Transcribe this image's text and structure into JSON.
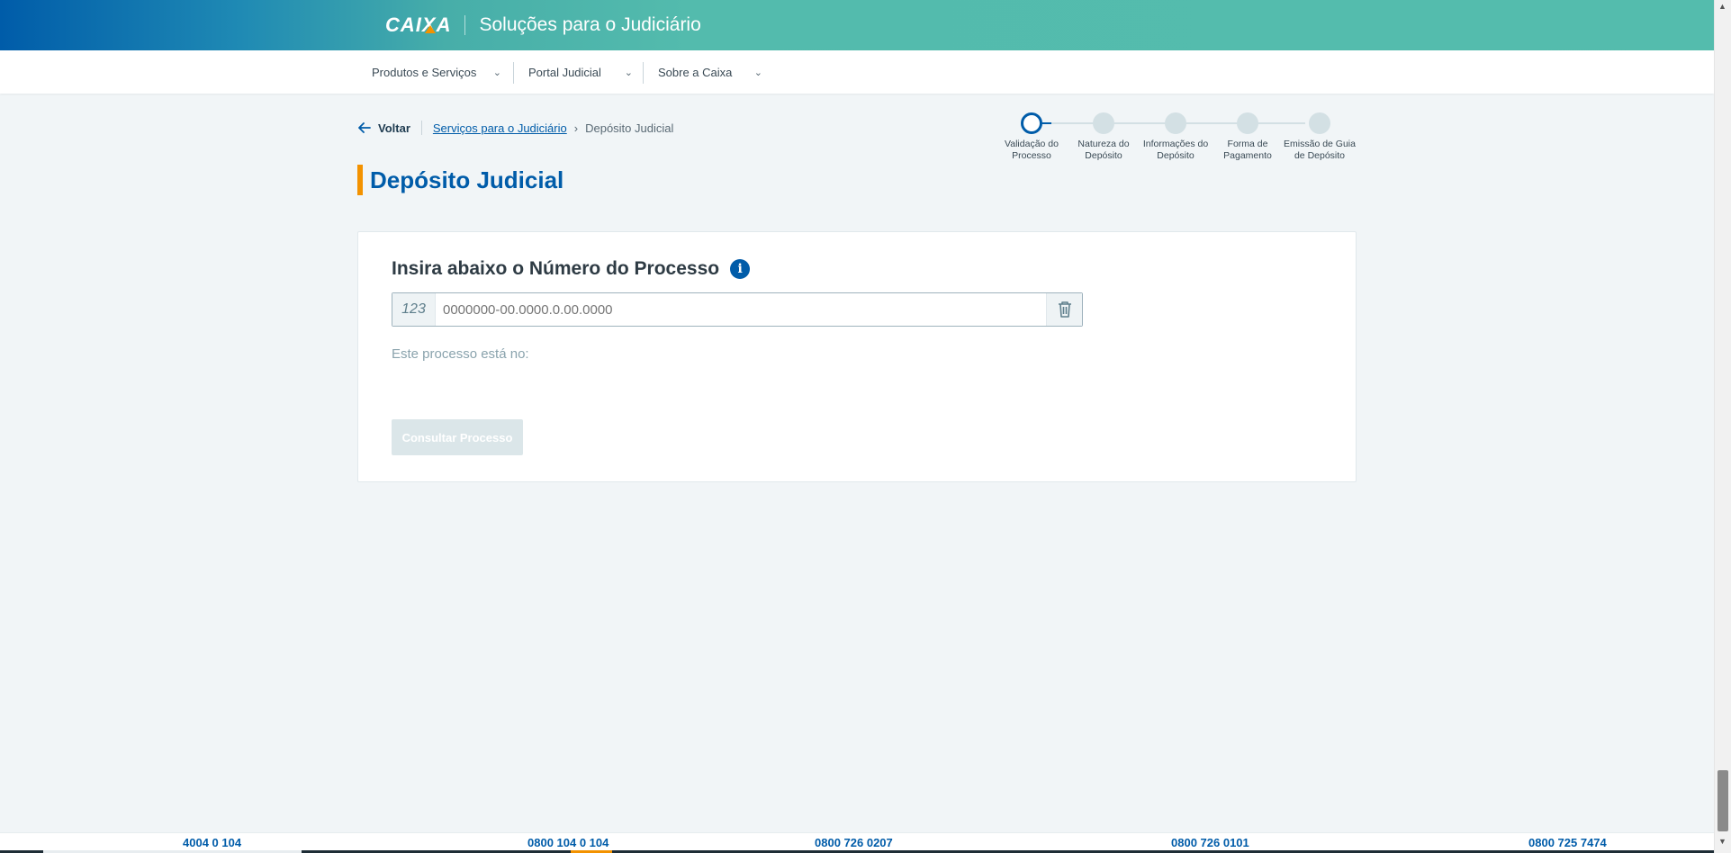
{
  "header": {
    "logo": "CAIXA",
    "title": "Soluções para o Judiciário"
  },
  "nav": {
    "items": [
      {
        "label": "Produtos e Serviços"
      },
      {
        "label": "Portal Judicial"
      },
      {
        "label": "Sobre a Caixa"
      }
    ]
  },
  "breadcrumb": {
    "back": "Voltar",
    "link": "Serviços para o Judiciário",
    "current": "Depósito Judicial"
  },
  "page": {
    "title": "Depósito Judicial"
  },
  "stepper": {
    "active_step": 1,
    "steps": [
      {
        "label": "Validação do Processo"
      },
      {
        "label": "Natureza do Depósito"
      },
      {
        "label": "Informações do Depósito"
      },
      {
        "label": "Forma de Pagamento"
      },
      {
        "label": "Emissão de Guia de Depósito"
      }
    ]
  },
  "form": {
    "heading": "Insira abaixo o Número do Processo",
    "input_prefix": "123",
    "input_placeholder": "0000000-00.0000.0.00.0000",
    "input_value": "",
    "process_location_label": "Este processo está no:",
    "submit_label": "Consultar Processo"
  },
  "footer": {
    "phones": [
      "4004 0 104",
      "0800 104 0 104",
      "0800 726 0207",
      "0800 726 0101",
      "0800 725 7474"
    ]
  },
  "colors": {
    "brand_blue": "#005ca9",
    "brand_orange": "#f39200",
    "brand_teal": "#54bcad"
  }
}
